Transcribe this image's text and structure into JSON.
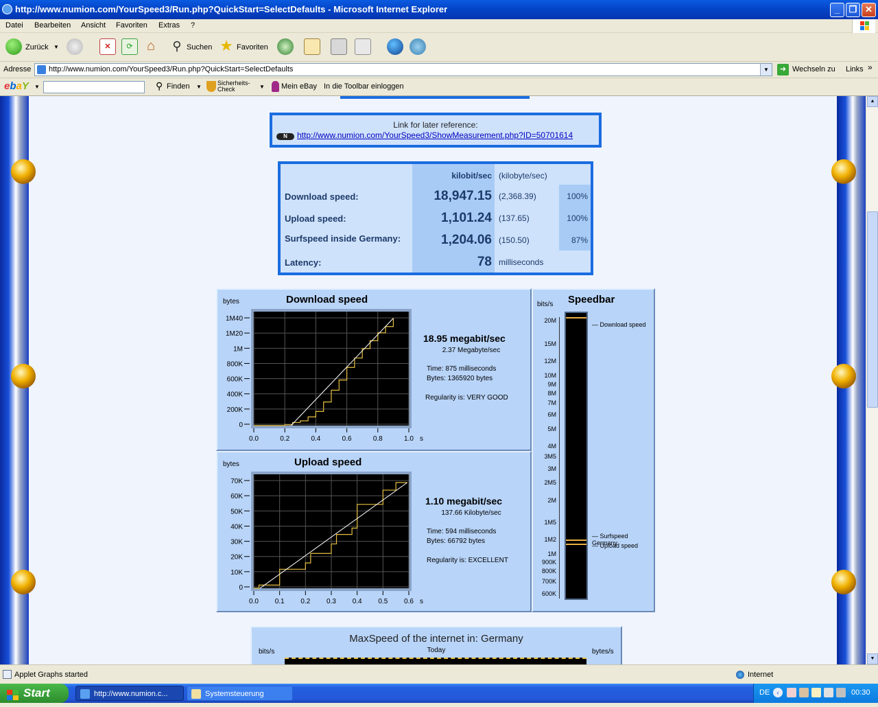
{
  "window": {
    "title": "http://www.numion.com/YourSpeed3/Run.php?QuickStart=SelectDefaults - Microsoft Internet Explorer"
  },
  "menu": [
    "Datei",
    "Bearbeiten",
    "Ansicht",
    "Favoriten",
    "Extras",
    "?"
  ],
  "toolbar": {
    "back": "Zurück",
    "search": "Suchen",
    "favorites": "Favoriten"
  },
  "address": {
    "label": "Adresse",
    "url": "http://www.numion.com/YourSpeed3/Run.php?QuickStart=SelectDefaults",
    "go": "Wechseln zu",
    "links": "Links"
  },
  "ebay": {
    "find": "Finden",
    "security": "Sicherheits-Check",
    "myebay": "Mein eBay",
    "login": "In die Toolbar einloggen"
  },
  "reference": {
    "label": "Link for later reference:",
    "url": "http://www.numion.com/YourSpeed3/ShowMeasurement.php?ID=50701614"
  },
  "results": {
    "col_kbit": "kilobit/sec",
    "col_kbyte": "(kilobyte/sec)",
    "rows": [
      {
        "label": "Download speed:",
        "kbit": "18,947.15",
        "kbyte": "(2,368.39)",
        "pct": "100%"
      },
      {
        "label": "Upload speed:",
        "kbit": "1,101.24",
        "kbyte": "(137.65)",
        "pct": "100%"
      },
      {
        "label": "Surfspeed inside Germany:",
        "kbit": "1,204.06",
        "kbyte": "(150.50)",
        "pct": "87%"
      }
    ],
    "latency_label": "Latency:",
    "latency_value": "78",
    "latency_unit": "milliseconds"
  },
  "download": {
    "title": "Download speed",
    "ylabel": "bytes",
    "xunit": "seconds",
    "speed": "18.95 megabit/sec",
    "mbyte": "2.37 Megabyte/sec",
    "time": "Time:   875 milliseconds",
    "bytes": "Bytes:  1365920 bytes",
    "regularity": "Regularity is: VERY GOOD"
  },
  "upload": {
    "title": "Upload speed",
    "ylabel": "bytes",
    "xunit": "seconds",
    "speed": "1.10 megabit/sec",
    "kbyte": "137.66 Kilobyte/sec",
    "time": "Time:   594 milliseconds",
    "bytes": "Bytes:  66792 bytes",
    "regularity": "Regularity is: EXCELLENT"
  },
  "speedbar": {
    "title": "Speedbar",
    "unit": "bits/s",
    "download": "Download speed",
    "surf": "Surfspeed Germany",
    "upload": "Upload speed"
  },
  "maxspeed": {
    "title": "MaxSpeed of the internet in: Germany",
    "left": "bits/s",
    "today": "Today",
    "right": "bytes/s"
  },
  "status": {
    "text": "Applet Graphs started",
    "zone": "Internet"
  },
  "taskbar": {
    "start": "Start",
    "task1": "http://www.numion.c...",
    "task2": "Systemsteuerung",
    "lang": "DE",
    "time": "00:30"
  },
  "chart_data": [
    {
      "type": "line",
      "title": "Download speed",
      "ylabel": "bytes",
      "xlabel": "seconds",
      "xlim": [
        0,
        1.0
      ],
      "ylim": [
        0,
        1450000
      ],
      "xticks": [
        "0.0",
        "0.2",
        "0.4",
        "0.6",
        "0.8",
        "1.0"
      ],
      "yticks": [
        "0",
        "200K",
        "400K",
        "600K",
        "800K",
        "1M",
        "1M20",
        "1M40"
      ],
      "series": [
        {
          "values": [
            [
              0,
              0
            ],
            [
              0.1,
              0
            ],
            [
              0.2,
              10000
            ],
            [
              0.25,
              40000
            ],
            [
              0.3,
              60000
            ],
            [
              0.35,
              110000
            ],
            [
              0.4,
              180000
            ],
            [
              0.45,
              300000
            ],
            [
              0.5,
              450000
            ],
            [
              0.55,
              580000
            ],
            [
              0.6,
              740000
            ],
            [
              0.65,
              860000
            ],
            [
              0.7,
              980000
            ],
            [
              0.75,
              1080000
            ],
            [
              0.8,
              1180000
            ],
            [
              0.85,
              1260000
            ],
            [
              0.9,
              1365920
            ]
          ]
        }
      ]
    },
    {
      "type": "line",
      "title": "Upload speed",
      "ylabel": "bytes",
      "xlabel": "seconds",
      "xlim": [
        0,
        0.6
      ],
      "ylim": [
        0,
        72000
      ],
      "xticks": [
        "0.0",
        "0.1",
        "0.2",
        "0.3",
        "0.4",
        "0.5",
        "0.6"
      ],
      "yticks": [
        "0",
        "10K",
        "20K",
        "30K",
        "40K",
        "50K",
        "60K",
        "70K"
      ],
      "series": [
        {
          "values": [
            [
              0,
              0
            ],
            [
              0.02,
              2000
            ],
            [
              0.1,
              6000
            ],
            [
              0.1,
              12000
            ],
            [
              0.2,
              16000
            ],
            [
              0.22,
              22000
            ],
            [
              0.3,
              28000
            ],
            [
              0.32,
              34000
            ],
            [
              0.38,
              38000
            ],
            [
              0.4,
              53000
            ],
            [
              0.5,
              62000
            ],
            [
              0.55,
              66792
            ],
            [
              0.594,
              66792
            ]
          ]
        }
      ]
    }
  ]
}
